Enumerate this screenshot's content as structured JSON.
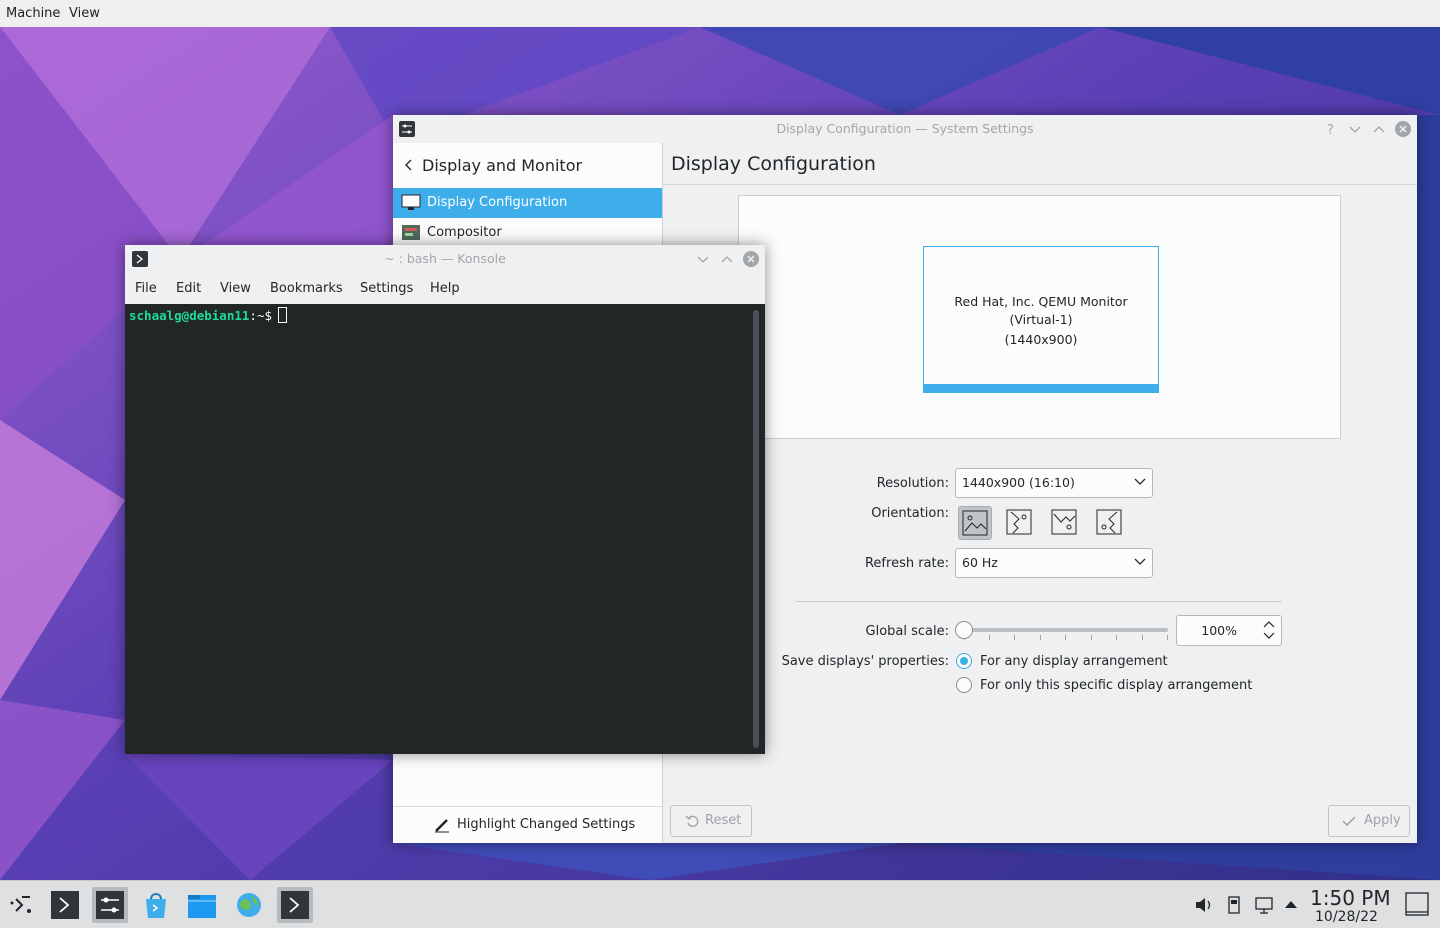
{
  "vm_menu": {
    "machine": "Machine",
    "view": "View"
  },
  "settings": {
    "title": "Display Configuration — System Settings",
    "sidebar_header": "Display and Monitor",
    "sidebar_items": [
      {
        "label": "Display Configuration",
        "selected": true
      },
      {
        "label": "Compositor",
        "selected": false
      }
    ],
    "highlight_label": "Highlight Changed Settings",
    "page_title": "Display Configuration",
    "monitor": {
      "name_line1": "Red Hat, Inc. QEMU Monitor",
      "name_line2": "(Virtual-1)",
      "resolution": "(1440x900)"
    },
    "resolution_label": "Resolution:",
    "resolution_value": "1440x900 (16:10)",
    "orientation_label": "Orientation:",
    "refresh_label": "Refresh rate:",
    "refresh_value": "60 Hz",
    "scale_label": "Global scale:",
    "scale_value": "100%",
    "scale_fraction": 0,
    "save_label": "Save displays' properties:",
    "radio_any": "For any display arrangement",
    "radio_specific": "For only this specific display arrangement",
    "reset_label": "Reset",
    "apply_label": "Apply",
    "accent_color": "#3daee9"
  },
  "konsole": {
    "title": "~ : bash — Konsole",
    "menu": [
      "File",
      "Edit",
      "View",
      "Bookmarks",
      "Settings",
      "Help"
    ],
    "prompt_user": "schaalg@debian11",
    "prompt_path": ":~$"
  },
  "taskbar": {
    "icons": [
      "launcher-icon",
      "konsole-icon",
      "system-settings-icon",
      "discover-icon",
      "dolphin-icon",
      "browser-icon",
      "konsole-icon"
    ],
    "tray_icons": [
      "volume-icon",
      "usb-icon",
      "network-icon",
      "arrow-up-icon"
    ],
    "time": "1:50 PM",
    "date": "10/28/22"
  }
}
